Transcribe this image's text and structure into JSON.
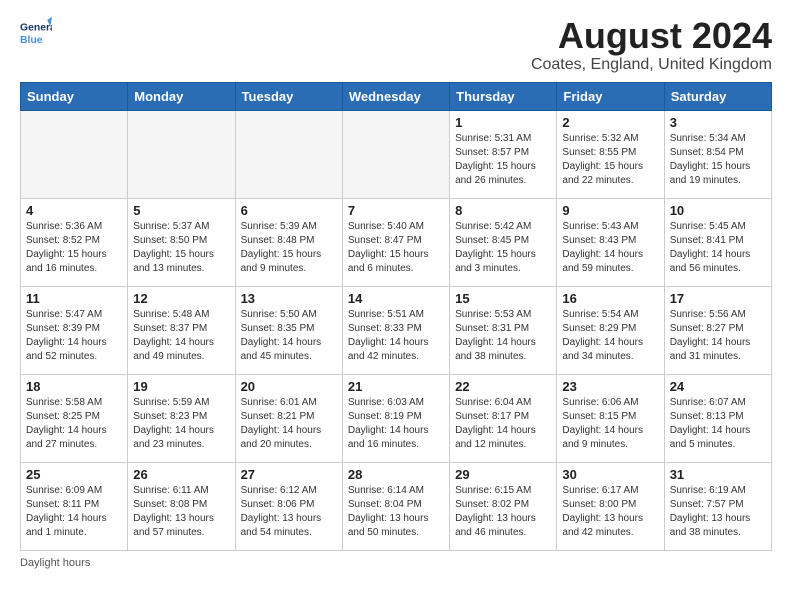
{
  "logo": {
    "line1": "General",
    "line2": "Blue"
  },
  "title": "August 2024",
  "location": "Coates, England, United Kingdom",
  "days_of_week": [
    "Sunday",
    "Monday",
    "Tuesday",
    "Wednesday",
    "Thursday",
    "Friday",
    "Saturday"
  ],
  "weeks": [
    [
      {
        "num": "",
        "info": ""
      },
      {
        "num": "",
        "info": ""
      },
      {
        "num": "",
        "info": ""
      },
      {
        "num": "",
        "info": ""
      },
      {
        "num": "1",
        "info": "Sunrise: 5:31 AM\nSunset: 8:57 PM\nDaylight: 15 hours\nand 26 minutes."
      },
      {
        "num": "2",
        "info": "Sunrise: 5:32 AM\nSunset: 8:55 PM\nDaylight: 15 hours\nand 22 minutes."
      },
      {
        "num": "3",
        "info": "Sunrise: 5:34 AM\nSunset: 8:54 PM\nDaylight: 15 hours\nand 19 minutes."
      }
    ],
    [
      {
        "num": "4",
        "info": "Sunrise: 5:36 AM\nSunset: 8:52 PM\nDaylight: 15 hours\nand 16 minutes."
      },
      {
        "num": "5",
        "info": "Sunrise: 5:37 AM\nSunset: 8:50 PM\nDaylight: 15 hours\nand 13 minutes."
      },
      {
        "num": "6",
        "info": "Sunrise: 5:39 AM\nSunset: 8:48 PM\nDaylight: 15 hours\nand 9 minutes."
      },
      {
        "num": "7",
        "info": "Sunrise: 5:40 AM\nSunset: 8:47 PM\nDaylight: 15 hours\nand 6 minutes."
      },
      {
        "num": "8",
        "info": "Sunrise: 5:42 AM\nSunset: 8:45 PM\nDaylight: 15 hours\nand 3 minutes."
      },
      {
        "num": "9",
        "info": "Sunrise: 5:43 AM\nSunset: 8:43 PM\nDaylight: 14 hours\nand 59 minutes."
      },
      {
        "num": "10",
        "info": "Sunrise: 5:45 AM\nSunset: 8:41 PM\nDaylight: 14 hours\nand 56 minutes."
      }
    ],
    [
      {
        "num": "11",
        "info": "Sunrise: 5:47 AM\nSunset: 8:39 PM\nDaylight: 14 hours\nand 52 minutes."
      },
      {
        "num": "12",
        "info": "Sunrise: 5:48 AM\nSunset: 8:37 PM\nDaylight: 14 hours\nand 49 minutes."
      },
      {
        "num": "13",
        "info": "Sunrise: 5:50 AM\nSunset: 8:35 PM\nDaylight: 14 hours\nand 45 minutes."
      },
      {
        "num": "14",
        "info": "Sunrise: 5:51 AM\nSunset: 8:33 PM\nDaylight: 14 hours\nand 42 minutes."
      },
      {
        "num": "15",
        "info": "Sunrise: 5:53 AM\nSunset: 8:31 PM\nDaylight: 14 hours\nand 38 minutes."
      },
      {
        "num": "16",
        "info": "Sunrise: 5:54 AM\nSunset: 8:29 PM\nDaylight: 14 hours\nand 34 minutes."
      },
      {
        "num": "17",
        "info": "Sunrise: 5:56 AM\nSunset: 8:27 PM\nDaylight: 14 hours\nand 31 minutes."
      }
    ],
    [
      {
        "num": "18",
        "info": "Sunrise: 5:58 AM\nSunset: 8:25 PM\nDaylight: 14 hours\nand 27 minutes."
      },
      {
        "num": "19",
        "info": "Sunrise: 5:59 AM\nSunset: 8:23 PM\nDaylight: 14 hours\nand 23 minutes."
      },
      {
        "num": "20",
        "info": "Sunrise: 6:01 AM\nSunset: 8:21 PM\nDaylight: 14 hours\nand 20 minutes."
      },
      {
        "num": "21",
        "info": "Sunrise: 6:03 AM\nSunset: 8:19 PM\nDaylight: 14 hours\nand 16 minutes."
      },
      {
        "num": "22",
        "info": "Sunrise: 6:04 AM\nSunset: 8:17 PM\nDaylight: 14 hours\nand 12 minutes."
      },
      {
        "num": "23",
        "info": "Sunrise: 6:06 AM\nSunset: 8:15 PM\nDaylight: 14 hours\nand 9 minutes."
      },
      {
        "num": "24",
        "info": "Sunrise: 6:07 AM\nSunset: 8:13 PM\nDaylight: 14 hours\nand 5 minutes."
      }
    ],
    [
      {
        "num": "25",
        "info": "Sunrise: 6:09 AM\nSunset: 8:11 PM\nDaylight: 14 hours\nand 1 minute."
      },
      {
        "num": "26",
        "info": "Sunrise: 6:11 AM\nSunset: 8:08 PM\nDaylight: 13 hours\nand 57 minutes."
      },
      {
        "num": "27",
        "info": "Sunrise: 6:12 AM\nSunset: 8:06 PM\nDaylight: 13 hours\nand 54 minutes."
      },
      {
        "num": "28",
        "info": "Sunrise: 6:14 AM\nSunset: 8:04 PM\nDaylight: 13 hours\nand 50 minutes."
      },
      {
        "num": "29",
        "info": "Sunrise: 6:15 AM\nSunset: 8:02 PM\nDaylight: 13 hours\nand 46 minutes."
      },
      {
        "num": "30",
        "info": "Sunrise: 6:17 AM\nSunset: 8:00 PM\nDaylight: 13 hours\nand 42 minutes."
      },
      {
        "num": "31",
        "info": "Sunrise: 6:19 AM\nSunset: 7:57 PM\nDaylight: 13 hours\nand 38 minutes."
      }
    ]
  ],
  "footer": {
    "daylight_label": "Daylight hours"
  }
}
